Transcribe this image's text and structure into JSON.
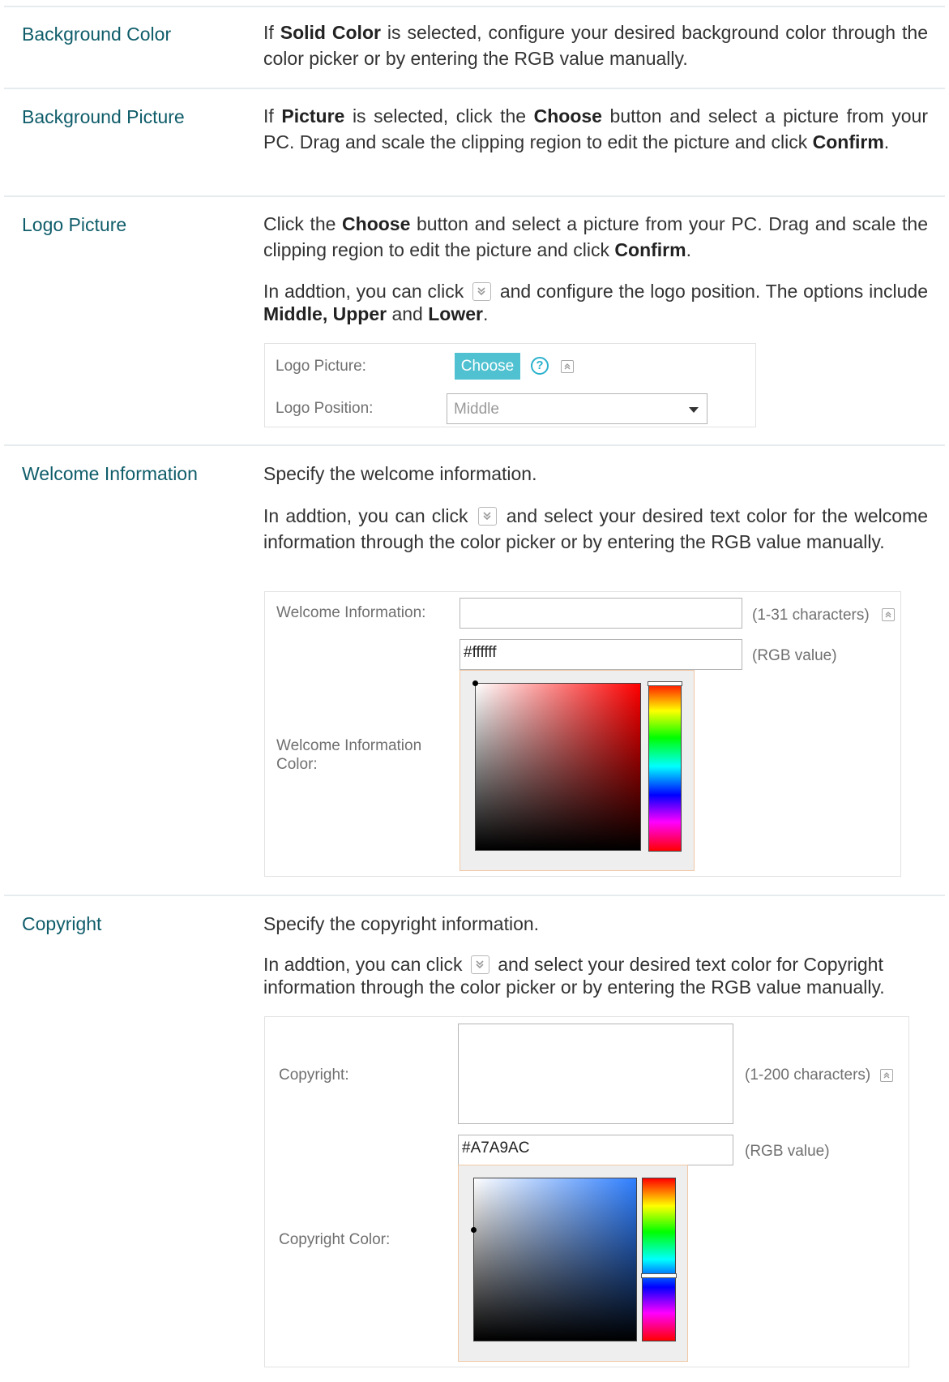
{
  "rows": {
    "background_color": {
      "term": "Background Color",
      "desc": {
        "p1": "If ",
        "b1": "Solid Color",
        "p2": " is selected, configure your desired background color through the color picker or by entering the RGB value manually."
      }
    },
    "background_picture": {
      "term": "Background Picture",
      "desc": {
        "p1": "If ",
        "b1": "Picture",
        "p2": " is selected, click the ",
        "b2": "Choose",
        "p3": " button and select a picture from your PC. Drag and scale the clipping region to edit the picture and click ",
        "b3": "Confirm",
        "p4": "."
      }
    },
    "logo_picture": {
      "term": "Logo Picture",
      "desc1": {
        "p1": "Click the ",
        "b1": "Choose",
        "p2": " button and select a picture from your PC. Drag and scale the clipping region to edit the picture and click ",
        "b2": "Confirm",
        "p3": "."
      },
      "desc2": {
        "p1": "In addtion, you can click ",
        "p2": " and configure the logo position. The options include ",
        "b1": "Middle, Upper",
        "p3": " and ",
        "b2": "Lower",
        "p4": "."
      },
      "screenshot": {
        "logo_label": "Logo Picture:",
        "choose_label": "Choose",
        "help_glyph": "?",
        "position_label": "Logo Position:",
        "position_value": "Middle"
      }
    },
    "welcome": {
      "term": "Welcome Information",
      "desc1": "Specify the welcome information.",
      "desc2": {
        "p1": "In addtion, you can click ",
        "p2": " and select your desired text color for the welcome information through the color picker or by entering the RGB value manually."
      },
      "screenshot": {
        "info_label": "Welcome Information:",
        "info_value": "",
        "info_hint": "(1-31 characters)",
        "rgb_value": "#ffffff",
        "rgb_hint": "(RGB value)",
        "color_label_1": "Welcome Information",
        "color_label_2": "Color:",
        "picker_hue_color": "#ff0000"
      }
    },
    "copyright": {
      "term": "Copyright",
      "desc1": "Specify the copyright information.",
      "desc2": {
        "p1": "In addtion, you can click ",
        "p2": " and select your desired text color for Copyright information through the color picker or by entering the RGB value manually."
      },
      "screenshot": {
        "copyright_label": "Copyright:",
        "copyright_value": "",
        "copyright_hint": "(1-200 characters)",
        "rgb_value": "#A7A9AC",
        "rgb_hint": "(RGB value)",
        "color_label": "Copyright Color:",
        "picker_hue_color": "#2f7fff"
      }
    }
  },
  "icons": {
    "expand": "expand-down-icon",
    "collapse": "collapse-up-icon",
    "help": "help-icon"
  },
  "colors": {
    "term": "#0f5d6a",
    "choose_button": "#4fc1d0",
    "help_icon": "#2bb1cd",
    "divider": "#e6ebee"
  }
}
